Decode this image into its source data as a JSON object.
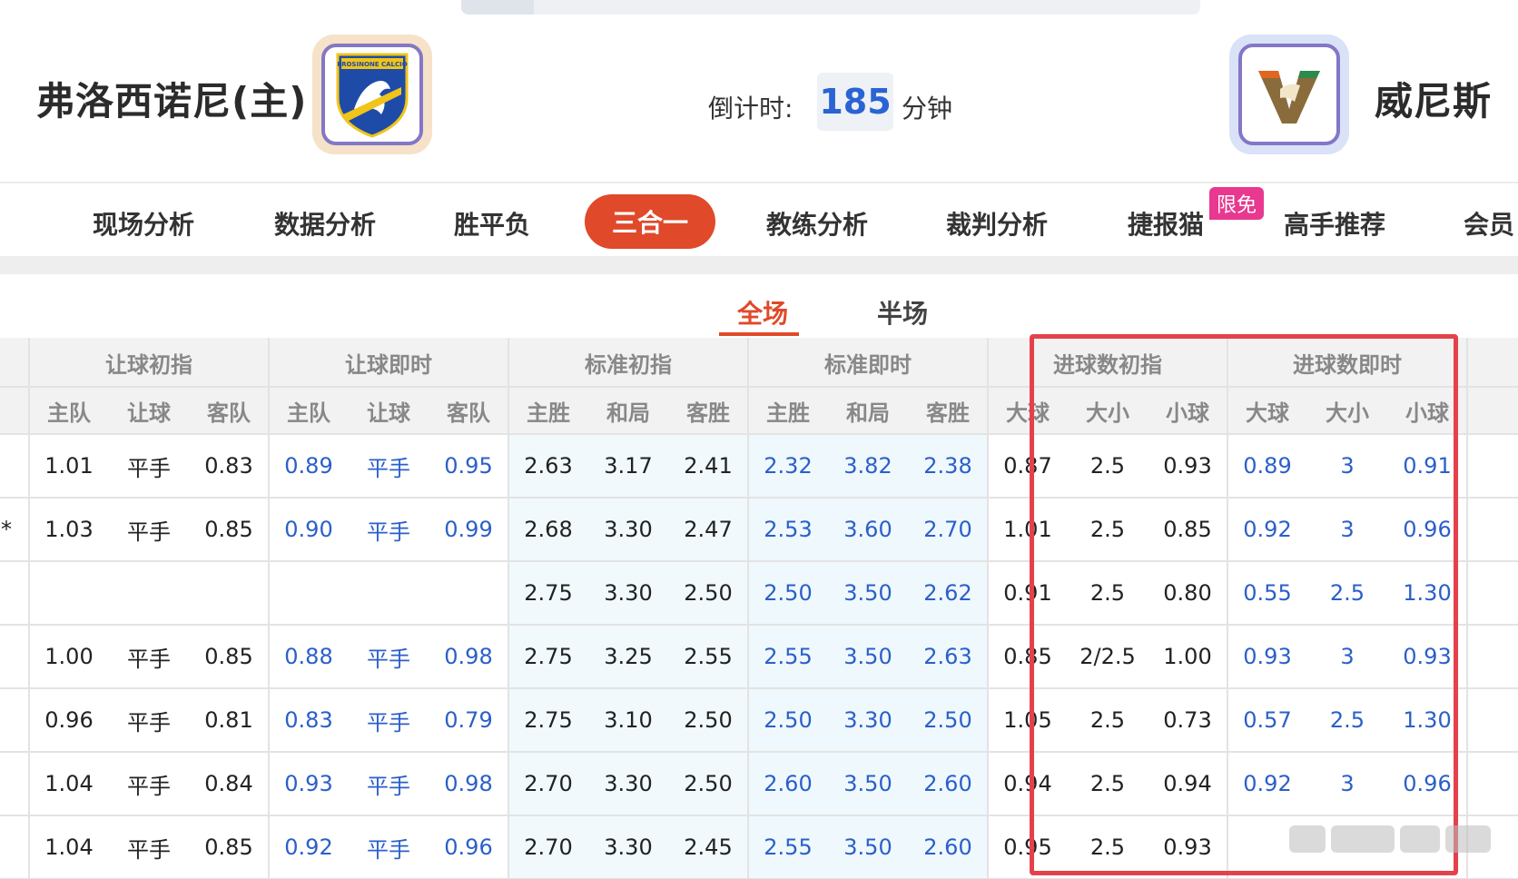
{
  "header": {
    "home_team": "弗洛西诺尼(主)",
    "away_team": "威尼斯",
    "home_logo_text": "FROSINONE CALCIO",
    "countdown_label": "倒计时:",
    "countdown_value": "185",
    "countdown_unit": "分钟"
  },
  "nav": {
    "items": [
      "现场分析",
      "数据分析",
      "胜平负",
      "三合一",
      "教练分析",
      "裁判分析",
      "捷报猫",
      "高手推荐",
      "会员"
    ],
    "active": "三合一",
    "badge": "限免"
  },
  "subtabs": {
    "full": "全场",
    "half": "半场",
    "active": "全场"
  },
  "table": {
    "groups": [
      "让球初指",
      "让球即时",
      "标准初指",
      "标准即时",
      "进球数初指",
      "进球数即时"
    ],
    "columns": [
      "主队",
      "让球",
      "客队",
      "主队",
      "让球",
      "客队",
      "主胜",
      "和局",
      "客胜",
      "主胜",
      "和局",
      "客胜",
      "大球",
      "大小",
      "小球",
      "大球",
      "大小",
      "小球"
    ],
    "row_markers": [
      "",
      "*",
      "",
      "",
      "",
      "",
      ""
    ],
    "rows": [
      [
        "1.01",
        "平手",
        "0.83",
        "0.89",
        "平手",
        "0.95",
        "2.63",
        "3.17",
        "2.41",
        "2.32",
        "3.82",
        "2.38",
        "0.87",
        "2.5",
        "0.93",
        "0.89",
        "3",
        "0.91"
      ],
      [
        "1.03",
        "平手",
        "0.85",
        "0.90",
        "平手",
        "0.99",
        "2.68",
        "3.30",
        "2.47",
        "2.53",
        "3.60",
        "2.70",
        "1.01",
        "2.5",
        "0.85",
        "0.92",
        "3",
        "0.96"
      ],
      [
        "",
        "",
        "",
        "",
        "",
        "",
        "2.75",
        "3.30",
        "2.50",
        "2.50",
        "3.50",
        "2.62",
        "0.91",
        "2.5",
        "0.80",
        "0.55",
        "2.5",
        "1.30"
      ],
      [
        "1.00",
        "平手",
        "0.85",
        "0.88",
        "平手",
        "0.98",
        "2.75",
        "3.25",
        "2.55",
        "2.55",
        "3.50",
        "2.63",
        "0.85",
        "2/2.5",
        "1.00",
        "0.93",
        "3",
        "0.93"
      ],
      [
        "0.96",
        "平手",
        "0.81",
        "0.83",
        "平手",
        "0.79",
        "2.75",
        "3.10",
        "2.50",
        "2.50",
        "3.30",
        "2.50",
        "1.05",
        "2.5",
        "0.73",
        "0.57",
        "2.5",
        "1.30"
      ],
      [
        "1.04",
        "平手",
        "0.84",
        "0.93",
        "平手",
        "0.98",
        "2.70",
        "3.30",
        "2.50",
        "2.60",
        "3.50",
        "2.60",
        "0.94",
        "2.5",
        "0.94",
        "0.92",
        "3",
        "0.96"
      ],
      [
        "1.04",
        "平手",
        "0.85",
        "0.92",
        "平手",
        "0.96",
        "2.70",
        "3.30",
        "2.45",
        "2.55",
        "3.50",
        "2.60",
        "0.95",
        "2.5",
        "0.93",
        "",
        "",
        ""
      ]
    ]
  },
  "colors": {
    "accent": "#e0492a",
    "blue_value": "#2b5fc9",
    "badge": "#e8388f",
    "highlight_box": "#e5414b"
  }
}
